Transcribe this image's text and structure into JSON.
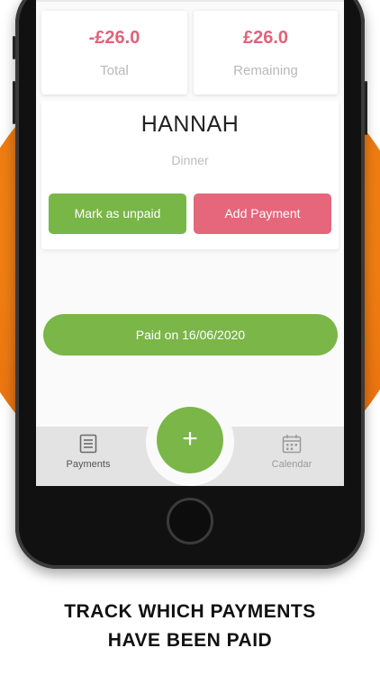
{
  "summary": {
    "total_amount": "-£26.0",
    "total_label": "Total",
    "remaining_amount": "£26.0",
    "remaining_label": "Remaining"
  },
  "person": {
    "name": "HANNAH",
    "meal": "Dinner"
  },
  "actions": {
    "mark_unpaid_label": "Mark as unpaid",
    "add_payment_label": "Add Payment"
  },
  "status": {
    "paid_label": "Paid on 16/06/2020"
  },
  "tabbar": {
    "payments_label": "Payments",
    "payments_icon": "list-document-icon",
    "calendar_label": "Calendar",
    "calendar_icon": "calendar-icon",
    "fab_icon": "plus-icon",
    "fab_glyph": "+"
  },
  "caption": {
    "line1": "TRACK WHICH PAYMENTS",
    "line2": "HAVE BEEN PAID"
  },
  "colors": {
    "accent_green": "#7ab648",
    "accent_pink": "#e6667b",
    "background_orange": "#ef7d12"
  }
}
